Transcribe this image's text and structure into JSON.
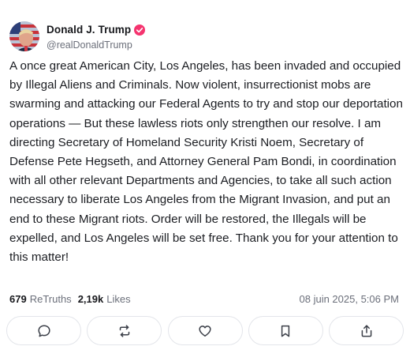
{
  "author": {
    "display_name": "Donald J. Trump",
    "handle": "@realDonaldTrump",
    "verified": true,
    "verified_color": "#f5346f"
  },
  "post": {
    "text": "A once great American City, Los Angeles, has been invaded and occupied by Illegal Aliens and Criminals.  Now violent, insurrectionist mobs are swarming and attacking our Federal Agents to try and stop our deportation operations — But these lawless riots only strengthen our resolve. I am directing Secretary of Homeland Security Kristi Noem, Secretary of Defense Pete Hegseth, and Attorney General Pam Bondi, in coordination with all other relevant Departments and Agencies, to take all such action necessary to liberate Los Angeles from the Migrant Invasion, and put an end to these Migrant riots. Order will be restored, the Illegals will be expelled, and Los Angeles will be set free. Thank you for your attention to this matter!"
  },
  "stats": {
    "retruths_count": "679",
    "retruths_label": "ReTruths",
    "likes_count": "2,19k",
    "likes_label": "Likes",
    "timestamp": "08 juin 2025, 5:06 PM"
  },
  "actions": [
    {
      "name": "reply",
      "icon": "reply-icon"
    },
    {
      "name": "retruth",
      "icon": "retruth-icon"
    },
    {
      "name": "like",
      "icon": "heart-icon"
    },
    {
      "name": "bookmark",
      "icon": "bookmark-icon"
    },
    {
      "name": "share",
      "icon": "share-icon"
    }
  ],
  "colors": {
    "text": "#1b1d22",
    "muted": "#6b6f7a",
    "border": "#e3e5ea"
  }
}
